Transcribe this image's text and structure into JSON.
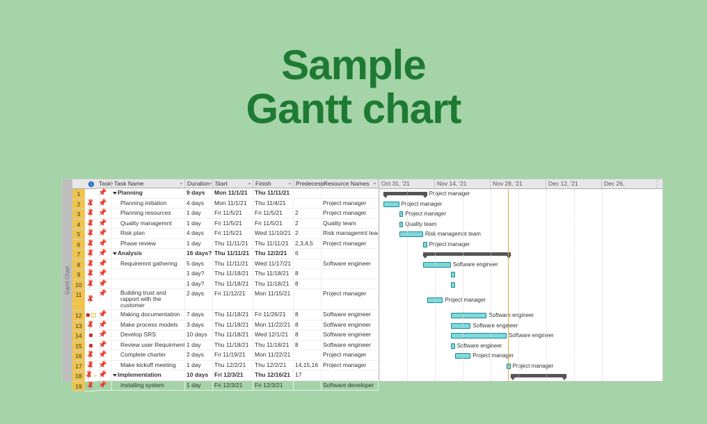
{
  "page_title_line1": "Sample",
  "page_title_line2": "Gantt chart",
  "sidebar_label": "Gantt Chart",
  "columns": {
    "task": "Task",
    "name": "Task Name",
    "duration": "Duration",
    "start": "Start",
    "finish": "Finish",
    "pred": "Predecess",
    "res": "Resource Names"
  },
  "timeline": [
    "Oct 31, '21",
    "Nov 14, '21",
    "Nov 28, '21",
    "Dec 12, '21",
    "Dec 26,"
  ],
  "rows": [
    {
      "id": "1",
      "pin": "",
      "name": "Planning",
      "dur": "9 days",
      "start": "Mon 11/1/21",
      "fin": "Thu 11/11/21",
      "pred": "",
      "res": "",
      "bold": true,
      "tw": true
    },
    {
      "id": "2",
      "pin": "p",
      "name": "Planning initiation",
      "dur": "4 days",
      "start": "Mon 11/1/21",
      "fin": "Thu 11/4/21",
      "pred": "",
      "res": "Project manager",
      "indent": true
    },
    {
      "id": "3",
      "pin": "p",
      "name": "Planning resources",
      "dur": "1 day",
      "start": "Fri 11/5/21",
      "fin": "Fri 11/5/21",
      "pred": "2",
      "res": "Project manager",
      "indent": true
    },
    {
      "id": "4",
      "pin": "p",
      "name": "Quality managemnt",
      "dur": "1 day",
      "start": "Fri 11/5/21",
      "fin": "Fri 11/5/21",
      "pred": "2",
      "res": "Quality team",
      "indent": true
    },
    {
      "id": "5",
      "pin": "p",
      "name": "Risk plan",
      "dur": "4 days",
      "start": "Fri 11/5/21",
      "fin": "Wed 11/10/21",
      "pred": "2",
      "res": "Risk managemnt team",
      "indent": true
    },
    {
      "id": "6",
      "pin": "p",
      "name": "Phase review",
      "dur": "1 day",
      "start": "Thu 11/11/21",
      "fin": "Thu 11/11/21",
      "pred": "2,3,4,5",
      "res": "Project manager",
      "indent": true
    },
    {
      "id": "7",
      "pin": "p",
      "name": "Analysis",
      "dur": "16 days?",
      "start": "Thu 11/11/21",
      "fin": "Thu 12/2/21",
      "pred": "6",
      "res": "",
      "bold": true,
      "tw": true
    },
    {
      "id": "8",
      "pin": "p",
      "name": "Requiremnt gathering",
      "dur": "5 days",
      "start": "Thu 11/11/21",
      "fin": "Wed 11/17/21",
      "pred": "",
      "res": "Software engineer",
      "indent": true
    },
    {
      "id": "9",
      "pin": "p",
      "name": "",
      "dur": "1 day?",
      "start": "Thu 11/18/21",
      "fin": "Thu 11/18/21",
      "pred": "8",
      "res": "",
      "indent": true
    },
    {
      "id": "10",
      "pin": "p",
      "name": "",
      "dur": "1 day?",
      "start": "Thu 11/18/21",
      "fin": "Thu 11/18/21",
      "pred": "8",
      "res": "",
      "indent": true
    },
    {
      "id": "11",
      "pin": "p",
      "name": "Building trust and rapport with the customer",
      "dur": "2 days",
      "start": "Fri 11/12/21",
      "fin": "Mon 11/15/21",
      "pred": "",
      "res": "Project manager",
      "indent": true,
      "tall": true
    },
    {
      "id": "12",
      "pin": "rn",
      "name": "Making documentation",
      "dur": "7 days",
      "start": "Thu 11/18/21",
      "fin": "Fri 11/26/21",
      "pred": "8",
      "res": "Software engineer",
      "indent": true
    },
    {
      "id": "13",
      "pin": "p",
      "name": "Make process models",
      "dur": "3 days",
      "start": "Thu 11/18/21",
      "fin": "Mon 11/22/21",
      "pred": "8",
      "res": "Software engineer",
      "indent": true
    },
    {
      "id": "14",
      "pin": "r",
      "name": "Develop SRS",
      "dur": "10 days",
      "start": "Thu 11/18/21",
      "fin": "Wed 12/1/21",
      "pred": "8",
      "res": "Software engineer",
      "indent": true
    },
    {
      "id": "15",
      "pin": "r",
      "name": "Review user Requirments",
      "dur": "1 day",
      "start": "Thu 11/18/21",
      "fin": "Thu 11/18/21",
      "pred": "8",
      "res": "Software engineer",
      "indent": true
    },
    {
      "id": "16",
      "pin": "p",
      "name": "Complete charter",
      "dur": "2 days",
      "start": "Fri 11/19/21",
      "fin": "Mon 11/22/21",
      "pred": "",
      "res": "Project manager",
      "indent": true
    },
    {
      "id": "17",
      "pin": "p",
      "name": "Make kickoff meeting",
      "dur": "1 day",
      "start": "Thu 12/2/21",
      "fin": "Thu 12/2/21",
      "pred": "14,15,16",
      "res": "Project manager",
      "indent": true
    },
    {
      "id": "18",
      "pin": "pn",
      "name": "Implementation",
      "dur": "10 days",
      "start": "Fri 12/3/21",
      "fin": "Thu 12/16/21",
      "pred": "17",
      "res": "",
      "bold": true,
      "tw": true
    },
    {
      "id": "19",
      "pin": "p",
      "name": "Installing system",
      "dur": "1 day",
      "start": "Fri 12/3/21",
      "fin": "Fri 12/3/21",
      "pred": "",
      "res": "Software developer",
      "indent": true
    }
  ],
  "chart_data": {
    "type": "gantt",
    "title": "Sample Gantt chart",
    "x_range": [
      "2021-10-31",
      "2021-12-26"
    ],
    "tasks": [
      {
        "id": 1,
        "name": "Planning",
        "type": "summary",
        "start": "2021-11-01",
        "finish": "2021-11-11",
        "label": "Project manager"
      },
      {
        "id": 2,
        "name": "Planning initiation",
        "type": "task",
        "start": "2021-11-01",
        "finish": "2021-11-04",
        "resource": "Project manager"
      },
      {
        "id": 3,
        "name": "Planning resources",
        "type": "task",
        "start": "2021-11-05",
        "finish": "2021-11-05",
        "resource": "Project manager",
        "predecessors": [
          2
        ]
      },
      {
        "id": 4,
        "name": "Quality managemnt",
        "type": "task",
        "start": "2021-11-05",
        "finish": "2021-11-05",
        "resource": "Quality team",
        "predecessors": [
          2
        ]
      },
      {
        "id": 5,
        "name": "Risk plan",
        "type": "task",
        "start": "2021-11-05",
        "finish": "2021-11-10",
        "resource": "Risk managemnt team",
        "predecessors": [
          2
        ]
      },
      {
        "id": 6,
        "name": "Phase review",
        "type": "task",
        "start": "2021-11-11",
        "finish": "2021-11-11",
        "resource": "Project manager",
        "predecessors": [
          2,
          3,
          4,
          5
        ]
      },
      {
        "id": 7,
        "name": "Analysis",
        "type": "summary",
        "start": "2021-11-11",
        "finish": "2021-12-02",
        "predecessors": [
          6
        ]
      },
      {
        "id": 8,
        "name": "Requiremnt gathering",
        "type": "task",
        "start": "2021-11-11",
        "finish": "2021-11-17",
        "resource": "Software engineer"
      },
      {
        "id": 9,
        "name": "",
        "type": "task",
        "start": "2021-11-18",
        "finish": "2021-11-18",
        "predecessors": [
          8
        ]
      },
      {
        "id": 10,
        "name": "",
        "type": "task",
        "start": "2021-11-18",
        "finish": "2021-11-18",
        "predecessors": [
          8
        ]
      },
      {
        "id": 11,
        "name": "Building trust and rapport with the customer",
        "type": "task",
        "start": "2021-11-12",
        "finish": "2021-11-15",
        "resource": "Project manager"
      },
      {
        "id": 12,
        "name": "Making documentation",
        "type": "task",
        "start": "2021-11-18",
        "finish": "2021-11-26",
        "resource": "Software engineer",
        "predecessors": [
          8
        ]
      },
      {
        "id": 13,
        "name": "Make process models",
        "type": "task",
        "start": "2021-11-18",
        "finish": "2021-11-22",
        "resource": "Software engineer",
        "predecessors": [
          8
        ]
      },
      {
        "id": 14,
        "name": "Develop SRS",
        "type": "task",
        "start": "2021-11-18",
        "finish": "2021-12-01",
        "resource": "Software engineer",
        "predecessors": [
          8
        ]
      },
      {
        "id": 15,
        "name": "Review user Requirments",
        "type": "task",
        "start": "2021-11-18",
        "finish": "2021-11-18",
        "resource": "Software engineer",
        "predecessors": [
          8
        ]
      },
      {
        "id": 16,
        "name": "Complete charter",
        "type": "task",
        "start": "2021-11-19",
        "finish": "2021-11-22",
        "resource": "Project manager"
      },
      {
        "id": 17,
        "name": "Make kickoff meeting",
        "type": "task",
        "start": "2021-12-02",
        "finish": "2021-12-02",
        "resource": "Project manager",
        "predecessors": [
          14,
          15,
          16
        ]
      },
      {
        "id": 18,
        "name": "Implementation",
        "type": "summary",
        "start": "2021-12-03",
        "finish": "2021-12-16",
        "predecessors": [
          17
        ]
      },
      {
        "id": 19,
        "name": "Installing system",
        "type": "task",
        "start": "2021-12-03",
        "finish": "2021-12-03",
        "resource": "Software developer"
      }
    ]
  }
}
